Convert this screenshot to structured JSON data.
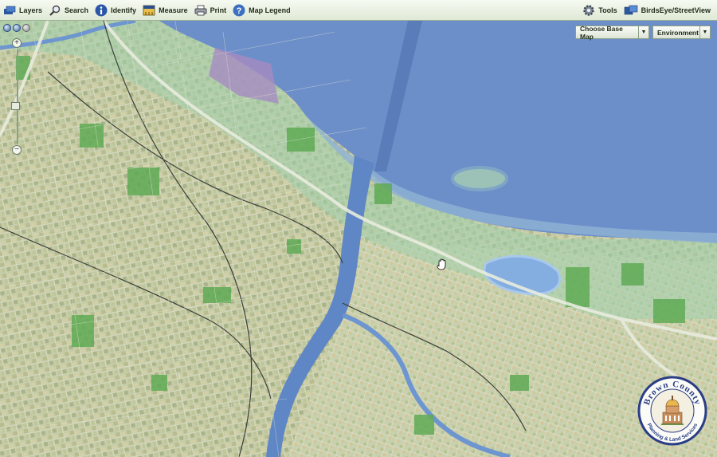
{
  "toolbar": {
    "layers": "Layers",
    "search": "Search",
    "identify": "Identify",
    "measure": "Measure",
    "print": "Print",
    "legend": "Map Legend",
    "tools": "Tools",
    "birdseye": "BirdsEye/StreetView"
  },
  "selects": {
    "basemap": "Choose Base Map",
    "environment": "Environment"
  },
  "logo": {
    "top_text": "Brown County",
    "bottom_text": "Planning & Land Services"
  },
  "zoom": {
    "plus": "+",
    "minus": "−"
  },
  "colors": {
    "water": "#6c8fc7",
    "land": "#c4cca6",
    "accent": "#2a4f8f"
  }
}
